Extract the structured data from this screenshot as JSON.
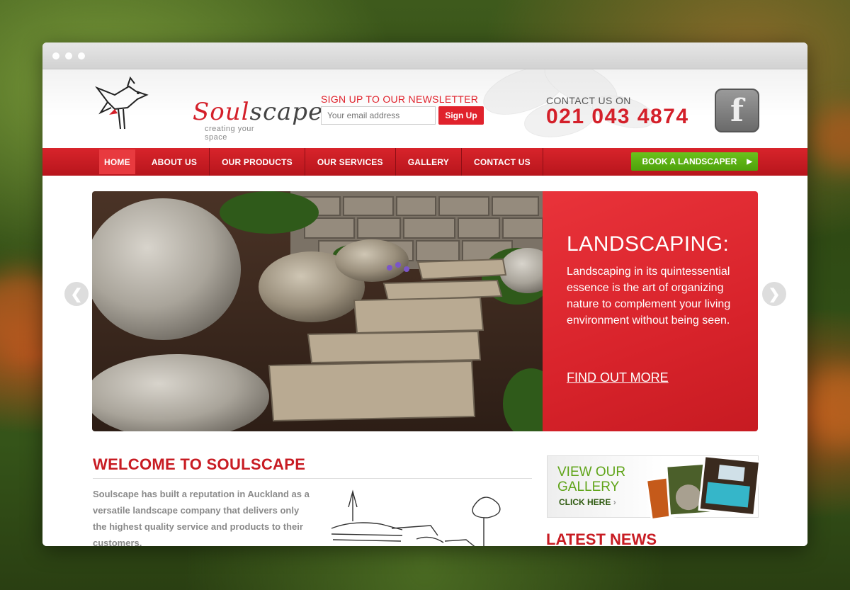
{
  "header": {
    "logo": {
      "word_red": "Soul",
      "word_grey": "scape",
      "tagline": "creating your space"
    },
    "newsletter": {
      "title": "SIGN UP TO OUR NEWSLETTER",
      "placeholder": "Your email address",
      "button": "Sign Up"
    },
    "contact": {
      "label": "CONTACT US ON",
      "phone": "021 043 4874"
    },
    "social": {
      "icon": "facebook-icon"
    }
  },
  "nav": {
    "items": [
      {
        "label": "HOME",
        "active": true
      },
      {
        "label": "ABOUT US"
      },
      {
        "label": "OUR PRODUCTS"
      },
      {
        "label": "OUR SERVICES"
      },
      {
        "label": "GALLERY"
      },
      {
        "label": "CONTACT US"
      }
    ],
    "cta": "BOOK A LANDSCAPER"
  },
  "slider": {
    "title": "LANDSCAPING:",
    "text": "Landscaping in its quintessential essence is the art of organizing nature to complement your living environment without being seen.",
    "link": "FIND OUT MORE"
  },
  "welcome": {
    "title": "WELCOME TO SOULSCAPE",
    "text": "Soulscape has built a reputation in Auckland as a versatile landscape company that delivers only the highest quality service and products to their customers."
  },
  "gallery": {
    "title_line1": "VIEW OUR",
    "title_line2": "GALLERY",
    "click": "CLICK HERE"
  },
  "news": {
    "title": "LATEST NEWS"
  },
  "colors": {
    "brand_red": "#d4202a",
    "cta_green": "#5fb214",
    "gallery_green": "#5fa418"
  }
}
